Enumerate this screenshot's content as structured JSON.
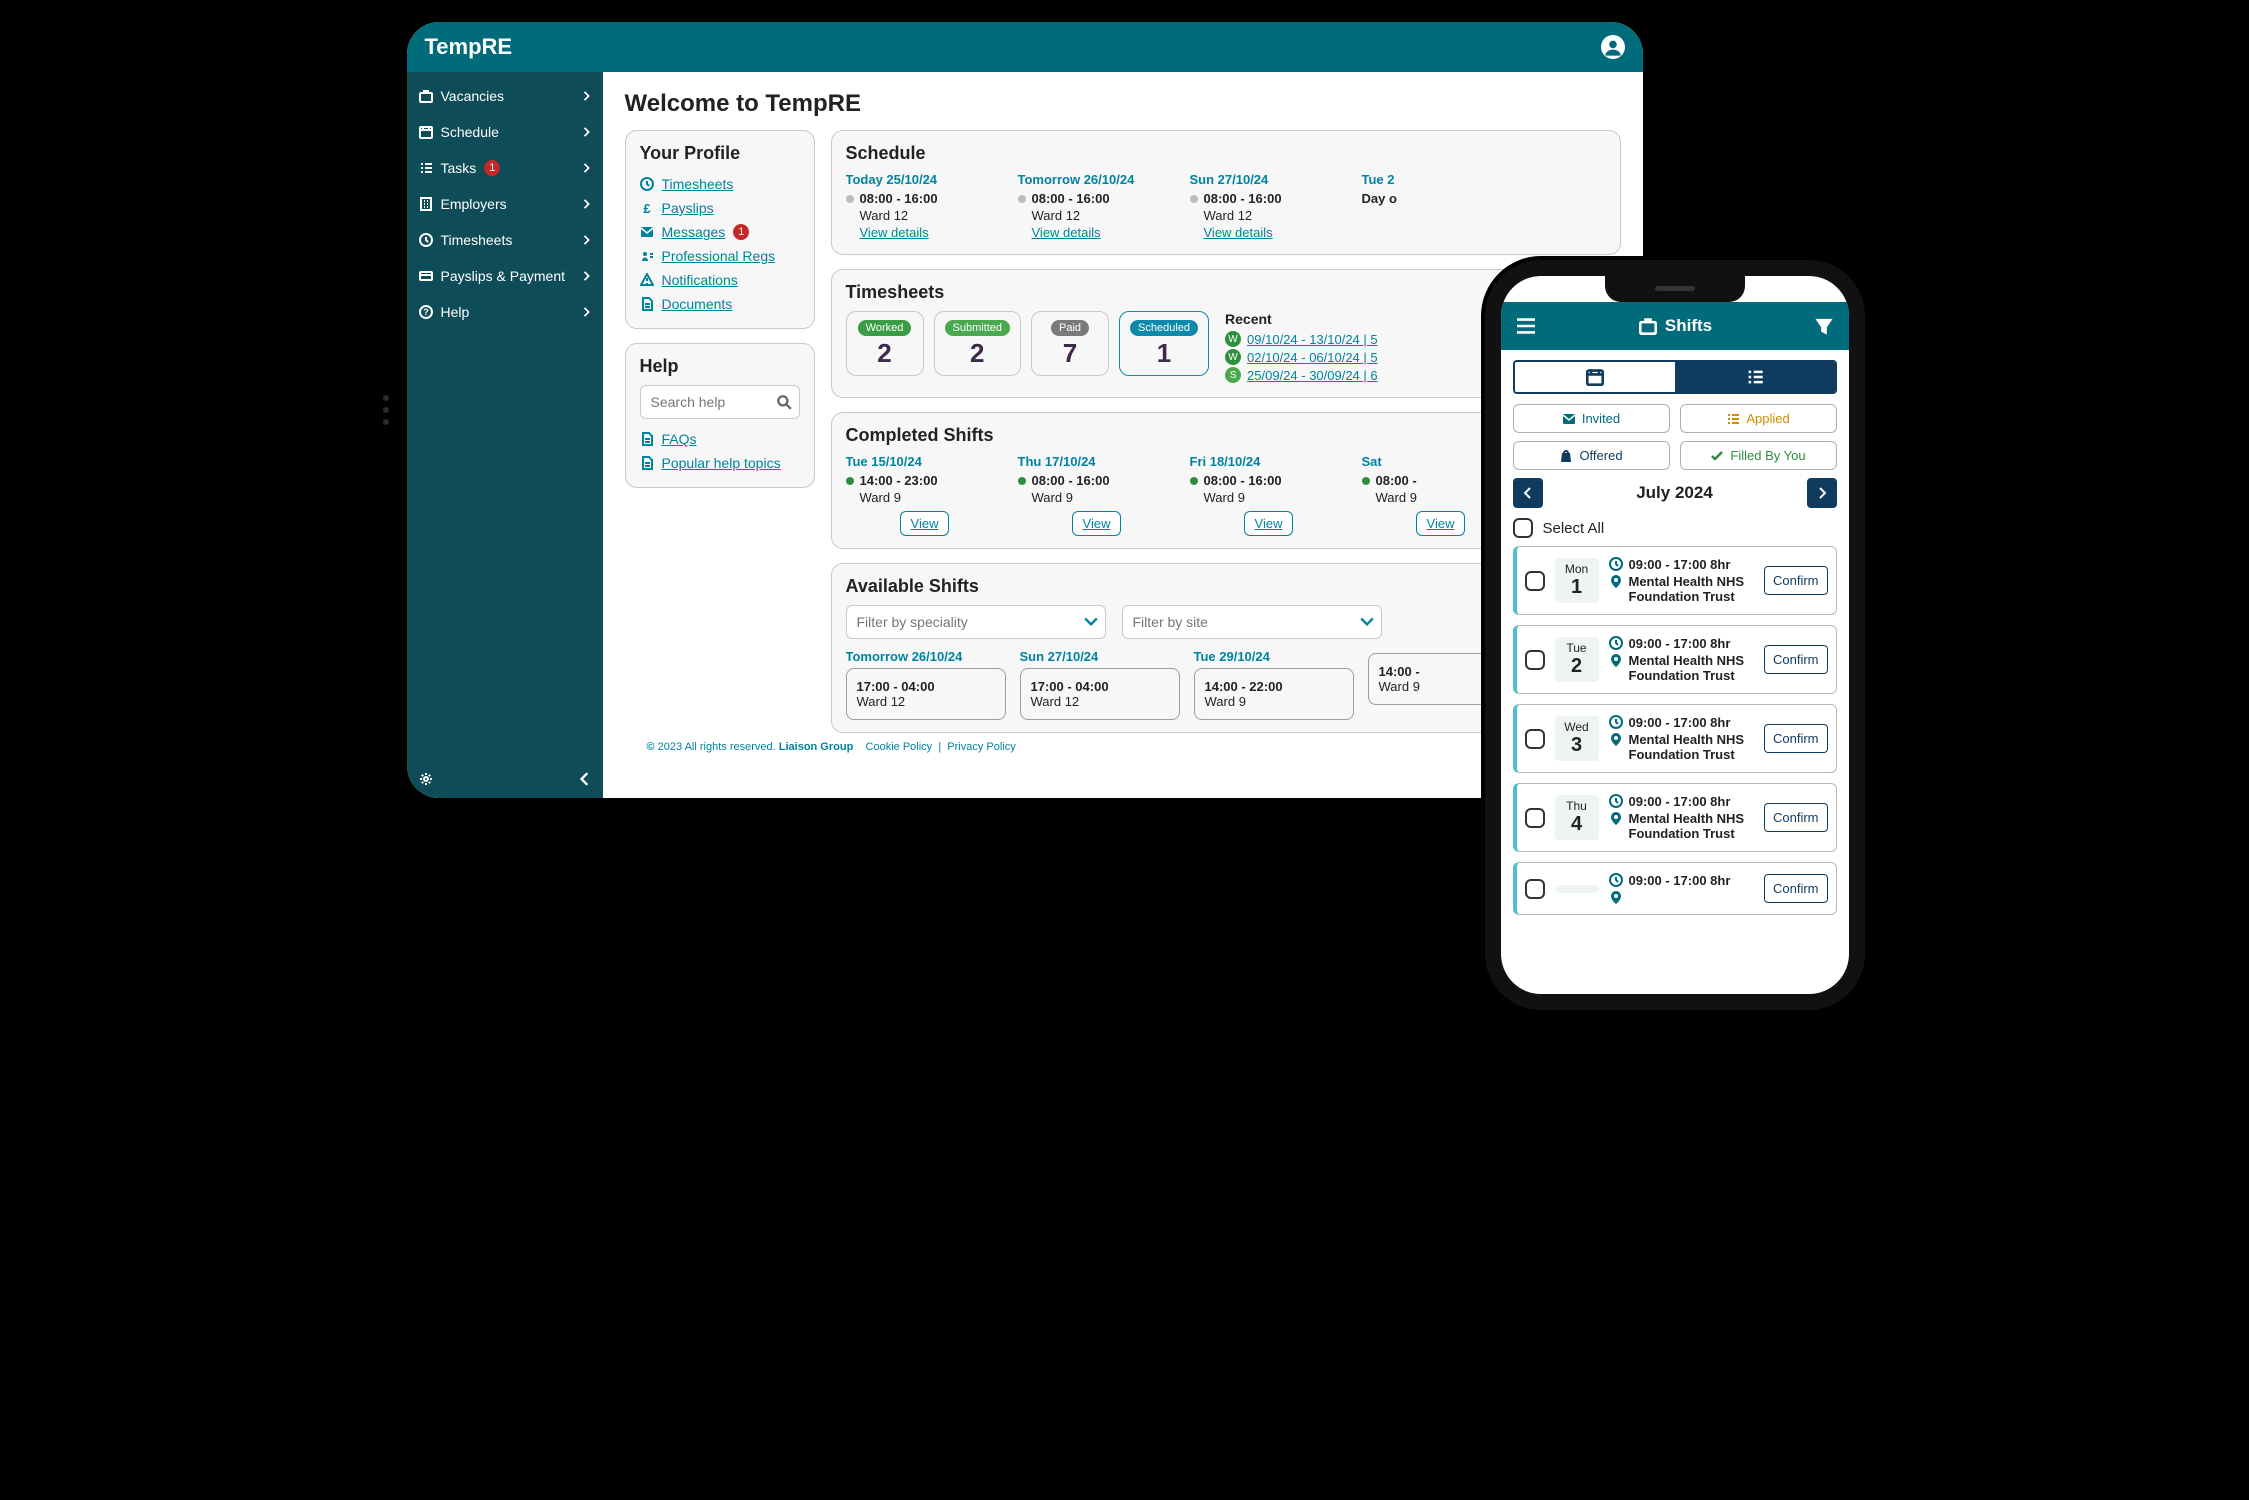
{
  "brand": "TempRE",
  "sidebar": {
    "items": [
      {
        "label": "Vacancies",
        "icon": "briefcase"
      },
      {
        "label": "Schedule",
        "icon": "calendar"
      },
      {
        "label": "Tasks",
        "icon": "list",
        "badge": "1"
      },
      {
        "label": "Employers",
        "icon": "building"
      },
      {
        "label": "Timesheets",
        "icon": "clock"
      },
      {
        "label": "Payslips & Payment",
        "icon": "card"
      },
      {
        "label": "Help",
        "icon": "question"
      }
    ]
  },
  "page_title": "Welcome to TempRE",
  "profile": {
    "title": "Your Profile",
    "items": [
      {
        "label": "Timesheets",
        "icon": "clock"
      },
      {
        "label": "Payslips",
        "icon": "pound"
      },
      {
        "label": "Messages",
        "icon": "mail",
        "badge": "1"
      },
      {
        "label": "Professional Regs",
        "icon": "person-card"
      },
      {
        "label": "Notifications",
        "icon": "alert"
      },
      {
        "label": "Documents",
        "icon": "doc"
      }
    ]
  },
  "help": {
    "title": "Help",
    "placeholder": "Search help",
    "links": [
      {
        "label": "FAQs"
      },
      {
        "label": "Popular help topics"
      }
    ]
  },
  "schedule": {
    "title": "Schedule",
    "view": "View details",
    "items": [
      {
        "day": "Today 25/10/24",
        "time": "08:00 - 16:00",
        "ward": "Ward 12",
        "dot": "gray"
      },
      {
        "day": "Tomorrow 26/10/24",
        "time": "08:00 - 16:00",
        "ward": "Ward 12",
        "dot": "gray"
      },
      {
        "day": "Sun 27/10/24",
        "time": "08:00 - 16:00",
        "ward": "Ward 12",
        "dot": "gray"
      },
      {
        "day": "Tue 2",
        "time": "Day o",
        "ward": "",
        "dot": "none"
      }
    ]
  },
  "timesheets": {
    "title": "Timesheets",
    "recent_title": "Recent",
    "counts": [
      {
        "label": "Worked",
        "n": "2",
        "cls": "w"
      },
      {
        "label": "Submitted",
        "n": "2",
        "cls": "s"
      },
      {
        "label": "Paid",
        "n": "7",
        "cls": "p"
      },
      {
        "label": "Scheduled",
        "n": "1",
        "cls": "sc",
        "sched": true
      }
    ],
    "recent": [
      {
        "b": "W",
        "range": "09/10/24 - 13/10/24 | 5"
      },
      {
        "b": "W",
        "range": "02/10/24 - 06/10/24 | 5"
      },
      {
        "b": "S",
        "range": "25/09/24 - 30/09/24 | 6"
      }
    ]
  },
  "completed": {
    "title": "Completed Shifts",
    "view": "View",
    "items": [
      {
        "day": "Tue 15/10/24",
        "time": "14:00 - 23:00",
        "ward": "Ward 9"
      },
      {
        "day": "Thu 17/10/24",
        "time": "08:00 - 16:00",
        "ward": "Ward 9"
      },
      {
        "day": "Fri 18/10/24",
        "time": "08:00 - 16:00",
        "ward": "Ward 9"
      },
      {
        "day": "Sat",
        "time": "08:00 -",
        "ward": "Ward 9"
      }
    ]
  },
  "available": {
    "title": "Available Shifts",
    "f1": "Filter by speciality",
    "f2": "Filter by site",
    "items": [
      {
        "day": "Tomorrow 26/10/24",
        "time": "17:00 - 04:00",
        "ward": "Ward 12"
      },
      {
        "day": "Sun 27/10/24",
        "time": "17:00 - 04:00",
        "ward": "Ward 12"
      },
      {
        "day": "Tue 29/10/24",
        "time": "14:00 - 22:00",
        "ward": "Ward 9"
      },
      {
        "day": "",
        "time": "14:00 -",
        "ward": "Ward 9"
      }
    ]
  },
  "footer": {
    "copy": "2023 All rights reserved.",
    "group": "Liaison Group",
    "cookie": "Cookie Policy",
    "sep": "|",
    "privacy": "Privacy Policy"
  },
  "mobile": {
    "title": "Shifts",
    "states": {
      "invited": "Invited",
      "applied": "Applied",
      "offered": "Offered",
      "filled": "Filled By You"
    },
    "month": "July 2024",
    "select_all": "Select All",
    "confirm": "Confirm",
    "shifts": [
      {
        "dw": "Mon",
        "dn": "1",
        "time": "09:00 - 17:00 8hr",
        "trust": "Mental Health NHS Foundation Trust"
      },
      {
        "dw": "Tue",
        "dn": "2",
        "time": "09:00 - 17:00 8hr",
        "trust": "Mental Health NHS Foundation Trust"
      },
      {
        "dw": "Wed",
        "dn": "3",
        "time": "09:00 - 17:00 8hr",
        "trust": "Mental Health NHS Foundation Trust"
      },
      {
        "dw": "Thu",
        "dn": "4",
        "time": "09:00 - 17:00 8hr",
        "trust": "Mental Health NHS Foundation Trust"
      },
      {
        "dw": "",
        "dn": "",
        "time": "09:00 - 17:00 8hr",
        "trust": ""
      }
    ]
  }
}
